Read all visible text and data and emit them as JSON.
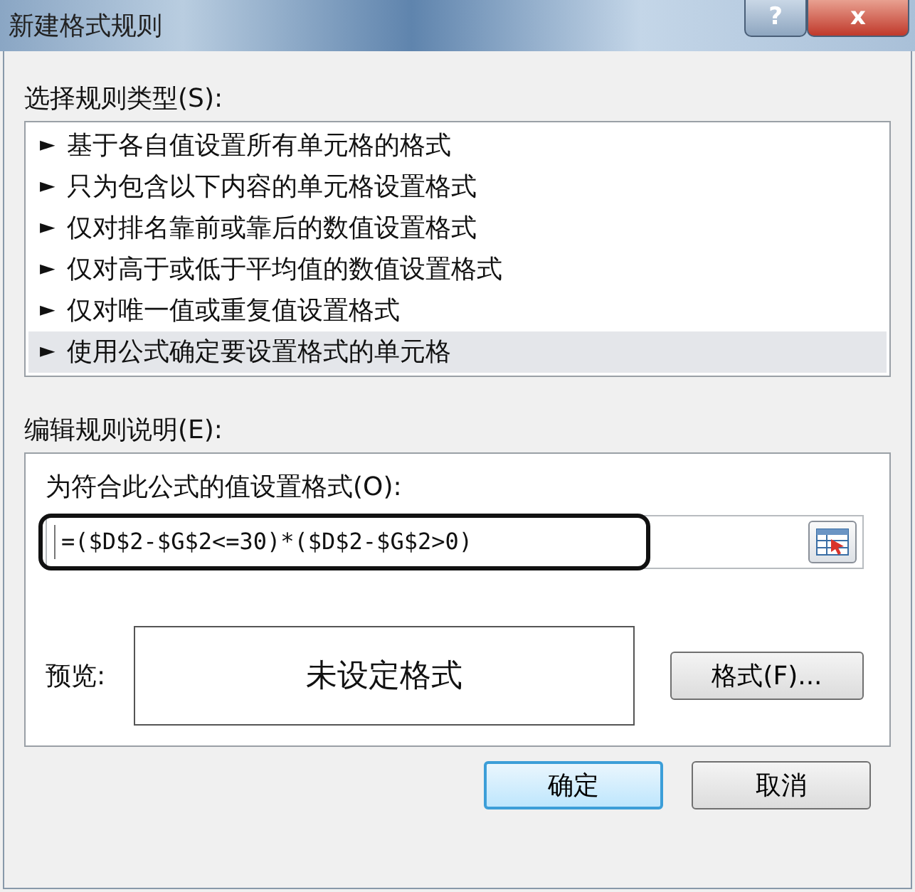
{
  "window": {
    "title": "新建格式规则",
    "help_button": "?",
    "close_button": "x"
  },
  "rule_type": {
    "label": "选择规则类型(S):",
    "items": [
      {
        "marker": "►",
        "text": "基于各自值设置所有单元格的格式",
        "selected": false
      },
      {
        "marker": "►",
        "text": "只为包含以下内容的单元格设置格式",
        "selected": false
      },
      {
        "marker": "►",
        "text": "仅对排名靠前或靠后的数值设置格式",
        "selected": false
      },
      {
        "marker": "►",
        "text": "仅对高于或低于平均值的数值设置格式",
        "selected": false
      },
      {
        "marker": "►",
        "text": "仅对唯一值或重复值设置格式",
        "selected": false
      },
      {
        "marker": "►",
        "text": "使用公式确定要设置格式的单元格",
        "selected": true
      }
    ]
  },
  "description": {
    "label": "编辑规则说明(E):",
    "formula_label": "为符合此公式的值设置格式(O):",
    "formula": "=($D$2-$G$2<=30)*($D$2-$G$2>0)",
    "formula_highlighted": true,
    "preview_label": "预览:",
    "preview_text": "未设定格式",
    "format_button": "格式(F)..."
  },
  "buttons": [
    {
      "label": "确定",
      "default": true
    },
    {
      "label": "取消",
      "default": false
    }
  ]
}
